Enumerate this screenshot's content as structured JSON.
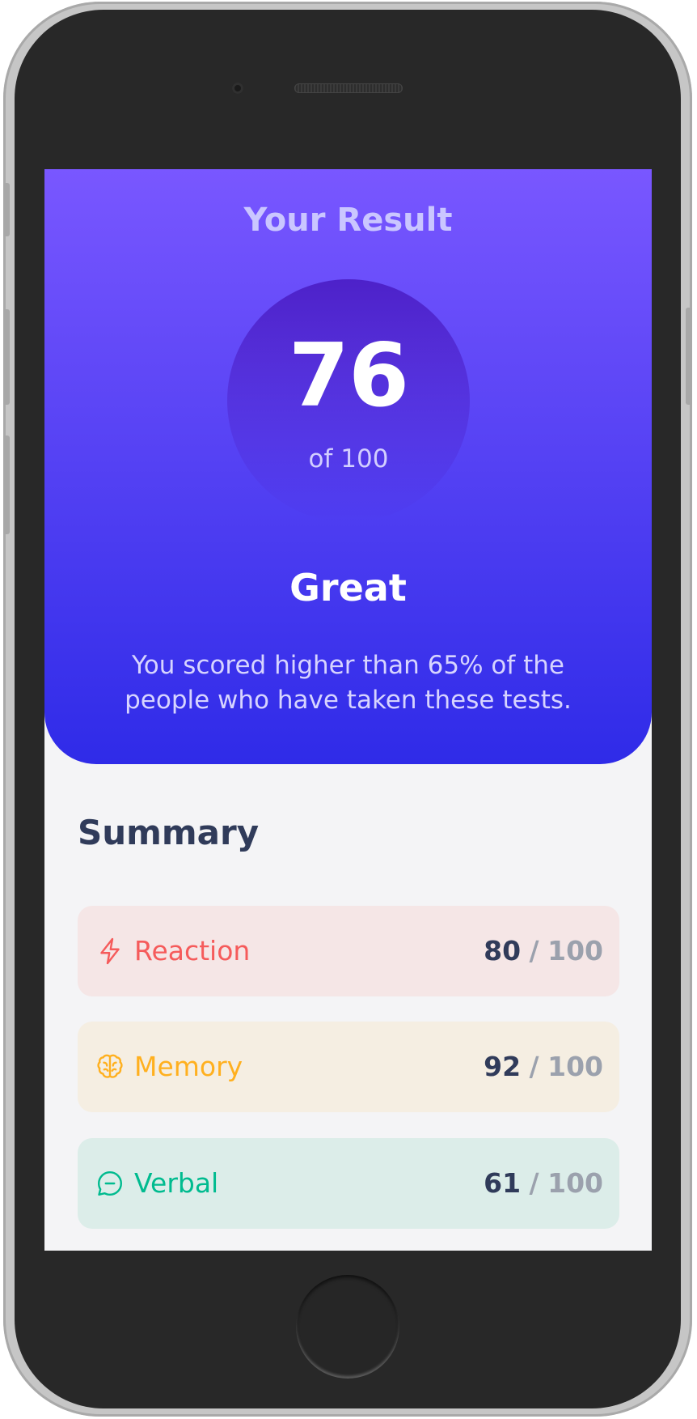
{
  "result": {
    "title": "Your Result",
    "score": "76",
    "score_max": "of 100",
    "rating": "Great",
    "description": "You scored higher than 65% of the people who have taken these tests.",
    "gradient_top": "#7957ff",
    "gradient_bottom": "#2f2be8"
  },
  "summary": {
    "title": "Summary",
    "items": [
      {
        "label": "Reaction",
        "icon": "lightning-icon",
        "score": "80",
        "separator": "/",
        "max": "100",
        "color": "#f55b5b",
        "background": "#f5e6e6"
      },
      {
        "label": "Memory",
        "icon": "brain-icon",
        "score": "92",
        "separator": "/",
        "max": "100",
        "color": "#ffb01f",
        "background": "#f5eee2"
      },
      {
        "label": "Verbal",
        "icon": "chat-bubble-icon",
        "score": "61",
        "separator": "/",
        "max": "100",
        "color": "#00bb8f",
        "background": "#dcede9"
      }
    ]
  }
}
